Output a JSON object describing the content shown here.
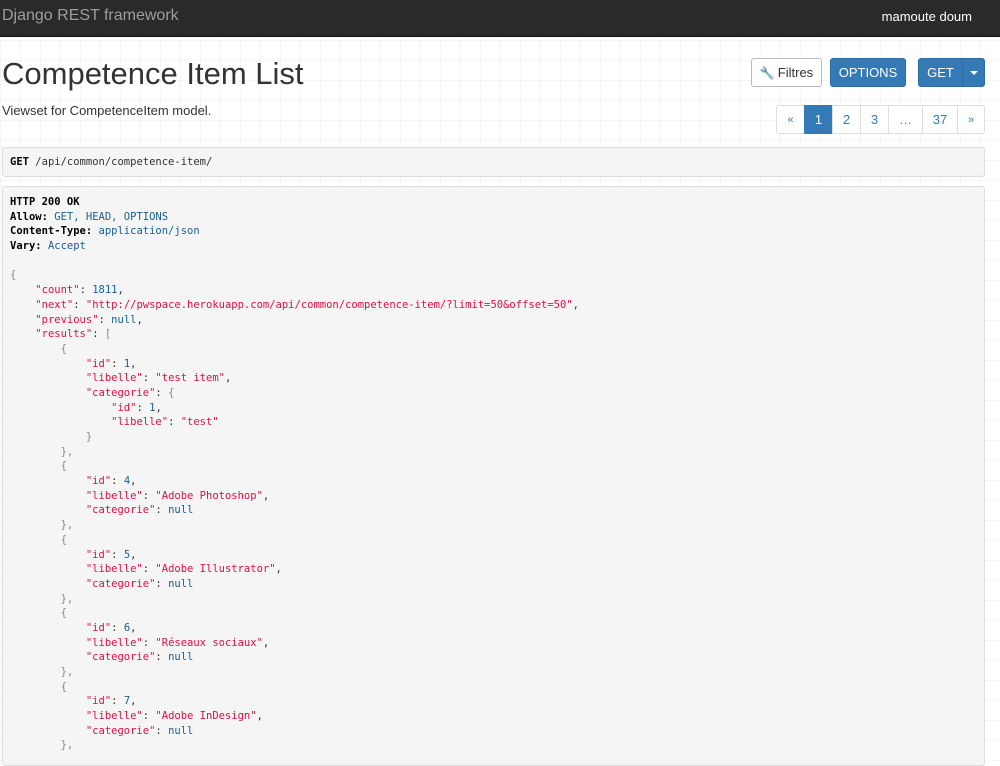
{
  "navbar": {
    "brand": "Django REST framework",
    "user": "mamoute doum"
  },
  "page": {
    "title": "Competence Item List",
    "description": "Viewset for CompetenceItem model."
  },
  "buttons": {
    "filters": "Filtres",
    "options": "OPTIONS",
    "get": "GET"
  },
  "pagination": {
    "prev": "«",
    "pages": [
      "1",
      "2",
      "3"
    ],
    "ellipsis": "…",
    "last": "37",
    "next": "»",
    "current": "1"
  },
  "request": {
    "method": "GET",
    "path": "/api/common/competence-item/"
  },
  "response": {
    "status": "HTTP 200 OK",
    "headers": [
      {
        "name": "Allow:",
        "value": "GET, HEAD, OPTIONS"
      },
      {
        "name": "Content-Type:",
        "value": "application/json"
      },
      {
        "name": "Vary:",
        "value": "Accept"
      }
    ],
    "count": "1811",
    "next": "\"http://pwspace.herokuapp.com/api/common/competence-item/?limit=50&offset=50\"",
    "previous": "null",
    "results": [
      {
        "id": "1",
        "libelle": "\"test item\"",
        "categorie": {
          "id": "1",
          "libelle": "\"test\""
        }
      },
      {
        "id": "4",
        "libelle": "\"Adobe Photoshop\"",
        "categorie": "null"
      },
      {
        "id": "5",
        "libelle": "\"Adobe Illustrator\"",
        "categorie": "null"
      },
      {
        "id": "6",
        "libelle": "\"Réseaux sociaux\"",
        "categorie": "null"
      },
      {
        "id": "7",
        "libelle": "\"Adobe InDesign\"",
        "categorie": "null"
      }
    ]
  }
}
